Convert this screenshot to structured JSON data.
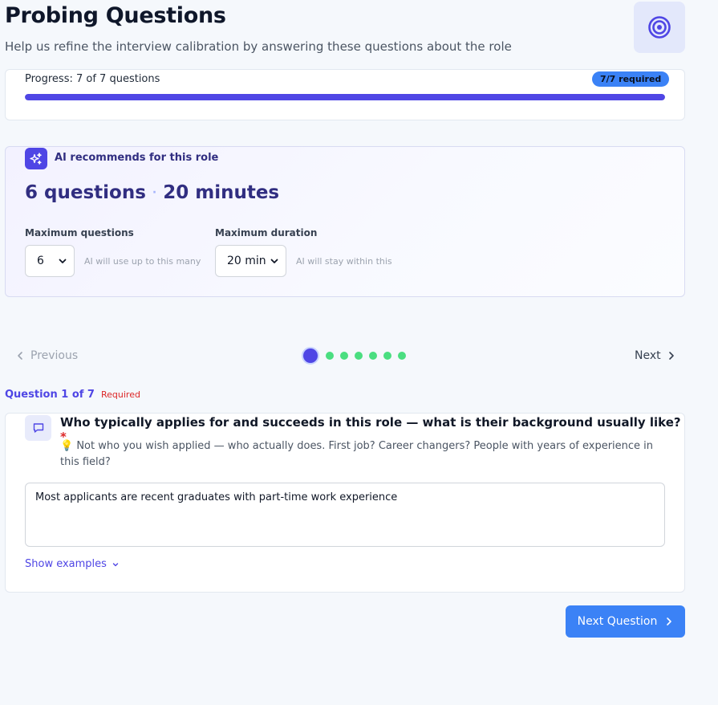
{
  "header": {
    "title": "Probing Questions",
    "subtitle": "Help us refine the interview calibration by answering these questions about the role",
    "icon": "target-icon"
  },
  "progress": {
    "label": "Progress: 7 of 7 questions",
    "badge": "7/7 required",
    "fraction": 1.0
  },
  "ai_recommendation": {
    "heading": "AI recommends for this role",
    "icon": "sparkles-icon",
    "questions_text": "6 questions",
    "separator": "·",
    "duration_text": "20 minutes",
    "max_questions": {
      "label": "Maximum questions",
      "value": "6",
      "hint": "AI will use up to this many"
    },
    "max_duration": {
      "label": "Maximum duration",
      "value": "20 min",
      "hint": "AI will stay within this"
    }
  },
  "navigation": {
    "previous_label": "Previous",
    "next_label": "Next",
    "total_steps": 7,
    "current_step": 1,
    "active_color": "#4f46e5",
    "complete_color": "#4ade80"
  },
  "question": {
    "number_label": "Question 1 of 7",
    "required_label": "Required",
    "icon": "chat-bubble-icon",
    "text": "Who typically applies for and succeeds in this role — what is their background usually like?",
    "required_marker": "*",
    "hint_emoji": "💡",
    "hint": "Not who you wish applied — who actually does. First job? Career changers? People with years of experience in this field?",
    "answer": "Most applicants are recent graduates with part-time work experience",
    "show_examples_label": "Show examples"
  },
  "footer": {
    "next_question_label": "Next Question"
  },
  "colors": {
    "accent": "#4f46e5",
    "primary_button": "#3b82f6",
    "required": "#dc2626",
    "page_background": "#f5f8fc"
  }
}
